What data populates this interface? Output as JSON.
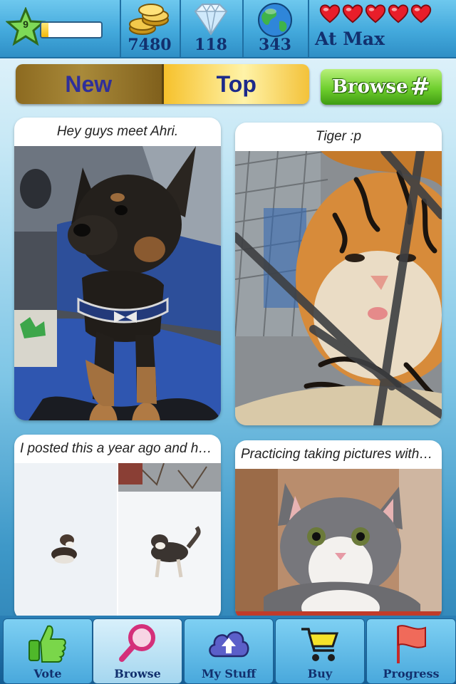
{
  "stats": {
    "level": "9",
    "level_progress": 0.12,
    "coins": "7480",
    "gems": "118",
    "world": "343",
    "lives_status": "At Max",
    "hearts": 5
  },
  "tabs": {
    "new_label": "New",
    "top_label": "Top",
    "selected": "Top"
  },
  "browse": {
    "label": "Browse",
    "hash": "#"
  },
  "posts": [
    {
      "caption": "Hey guys meet Ahri.",
      "image": "puppy-photo"
    },
    {
      "caption": "Tiger :p",
      "image": "tiger-photo"
    },
    {
      "caption": "I posted this a year ago and he...",
      "image": "husky-snow-photo"
    },
    {
      "caption": "Practicing taking pictures with my...",
      "image": "kitten-photo"
    }
  ],
  "bottom_nav": [
    {
      "label": "Vote",
      "icon": "thumbs-up-icon"
    },
    {
      "label": "Browse",
      "icon": "magnifier-icon"
    },
    {
      "label": "My Stuff",
      "icon": "cloud-upload-icon"
    },
    {
      "label": "Buy",
      "icon": "cart-icon"
    },
    {
      "label": "Progress",
      "icon": "flag-icon"
    }
  ],
  "colors": {
    "accent": "#43a9dc",
    "label": "#12306e",
    "browse_green": "#6fcf2e",
    "gold": "#f6c12c"
  }
}
